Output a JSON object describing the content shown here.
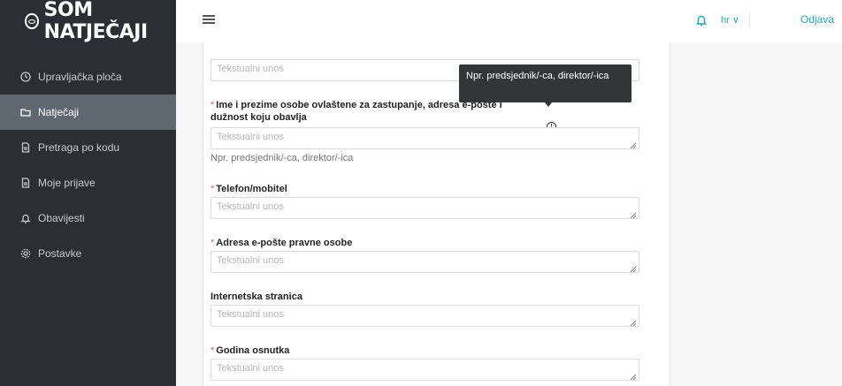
{
  "app": {
    "logo_text": "SOM NATJEČAJI"
  },
  "sidebar": {
    "items": [
      {
        "label": "Upravljačka ploča",
        "icon": "clock-icon"
      },
      {
        "label": "Natječaji",
        "icon": "folder-icon",
        "active": true
      },
      {
        "label": "Pretraga po kodu",
        "icon": "file-icon"
      },
      {
        "label": "Moje prijave",
        "icon": "file-icon"
      },
      {
        "label": "Obavijesti",
        "icon": "bell-icon"
      },
      {
        "label": "Postavke",
        "icon": "gear-icon"
      }
    ]
  },
  "header": {
    "language": "hr",
    "logout_label": "Odjava"
  },
  "form": {
    "placeholder": "Tekstualni unos",
    "fields": [
      {
        "label": "",
        "required": false
      },
      {
        "label": "Ime i prezime osobe ovlaštene za zastupanje, adresa e-pošte i dužnost koju obavlja",
        "required": true,
        "help": "Npr. predsjednik/-ca, direktor/-ica"
      },
      {
        "label": "Telefon/mobitel",
        "required": true
      },
      {
        "label": "Adresa e-pošte pravne osobe",
        "required": true
      },
      {
        "label": "Internetska stranica",
        "required": false
      },
      {
        "label": "Godina osnutka",
        "required": true
      }
    ]
  },
  "tooltip": {
    "text": "Npr. predsjednik/-ca, direktor/-ica"
  },
  "colors": {
    "sidebar_bg": "#2b2f33",
    "active_item": "#5f6870",
    "accent": "#2aa6b8",
    "required": "#e05c5c"
  }
}
